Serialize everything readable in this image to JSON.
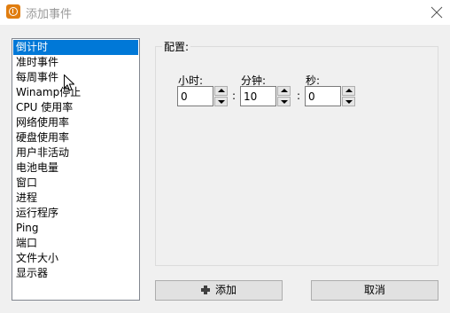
{
  "window": {
    "title": "添加事件",
    "icon": "app-clock-icon",
    "close": "close-icon"
  },
  "event_list": {
    "items": [
      "倒计时",
      "准时事件",
      "每周事件",
      "Winamp停止",
      "CPU 使用率",
      "网络使用率",
      "硬盘使用率",
      "用户非活动",
      "电池电量",
      "窗口",
      "进程",
      "运行程序",
      "Ping",
      "端口",
      "文件大小",
      "显示器"
    ],
    "selected": "倒计时"
  },
  "config": {
    "group_label": "配置:",
    "hours": {
      "label": "小时:",
      "value": "0"
    },
    "minutes": {
      "label": "分钟:",
      "value": "10"
    },
    "seconds": {
      "label": "秒:",
      "value": "0"
    },
    "separator": ":"
  },
  "buttons": {
    "add": {
      "label": "添加",
      "icon": "plus-icon"
    },
    "cancel": {
      "label": "取消"
    }
  },
  "colors": {
    "selection": "#0078d7",
    "app_icon": "#e07d10"
  }
}
